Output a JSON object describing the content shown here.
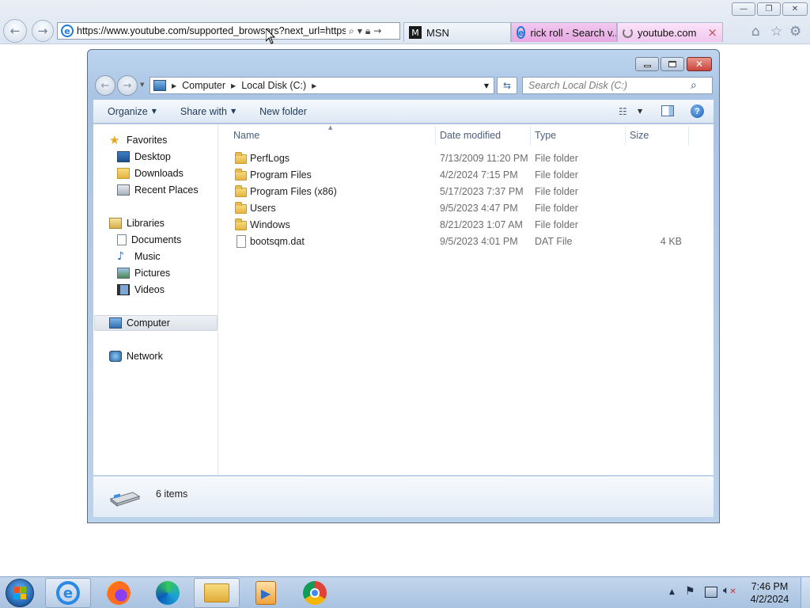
{
  "browser": {
    "address_url": "https://www.youtube.com/supported_browsers?next_url=https?",
    "tabs": [
      {
        "label": "MSN"
      },
      {
        "label": "rick roll - Search v..."
      },
      {
        "label": "youtube.com"
      }
    ],
    "tab_close": "×",
    "window_controls": {
      "minimize": "—",
      "maximize": "❐",
      "close": "✕"
    },
    "icons": [
      "home-icon",
      "favorites-star-icon",
      "tools-gear-icon"
    ]
  },
  "explorer": {
    "breadcrumb": [
      "Computer",
      "Local Disk (C:)"
    ],
    "search_placeholder": "Search Local Disk (C:)",
    "toolbar": {
      "organize": "Organize",
      "share_with": "Share with",
      "new_folder": "New folder"
    },
    "nav_pane": {
      "favorites": "Favorites",
      "desktop": "Desktop",
      "downloads": "Downloads",
      "recent_places": "Recent Places",
      "libraries": "Libraries",
      "documents": "Documents",
      "music": "Music",
      "pictures": "Pictures",
      "videos": "Videos",
      "computer": "Computer",
      "network": "Network"
    },
    "columns": {
      "name": "Name",
      "date_modified": "Date modified",
      "type": "Type",
      "size": "Size"
    },
    "files": [
      {
        "name": "PerfLogs",
        "date": "7/13/2009 11:20 PM",
        "type": "File folder",
        "size": "",
        "kind": "folder"
      },
      {
        "name": "Program Files",
        "date": "4/2/2024 7:15 PM",
        "type": "File folder",
        "size": "",
        "kind": "folder"
      },
      {
        "name": "Program Files (x86)",
        "date": "5/17/2023 7:37 PM",
        "type": "File folder",
        "size": "",
        "kind": "folder"
      },
      {
        "name": "Users",
        "date": "9/5/2023 4:47 PM",
        "type": "File folder",
        "size": "",
        "kind": "folder"
      },
      {
        "name": "Windows",
        "date": "8/21/2023 1:07 AM",
        "type": "File folder",
        "size": "",
        "kind": "folder"
      },
      {
        "name": "bootsqm.dat",
        "date": "9/5/2023 4:01 PM",
        "type": "DAT File",
        "size": "4 KB",
        "kind": "file"
      }
    ],
    "status": "6 items"
  },
  "taskbar": {
    "apps": [
      "internet-explorer",
      "firefox",
      "edge",
      "file-explorer",
      "media-player",
      "chrome"
    ],
    "time": "7:46 PM",
    "date": "4/2/2024"
  },
  "colors": {
    "accent": "#1e7ad6",
    "explorer_frame": "#a9c4e4",
    "close_red": "#c9463d"
  }
}
